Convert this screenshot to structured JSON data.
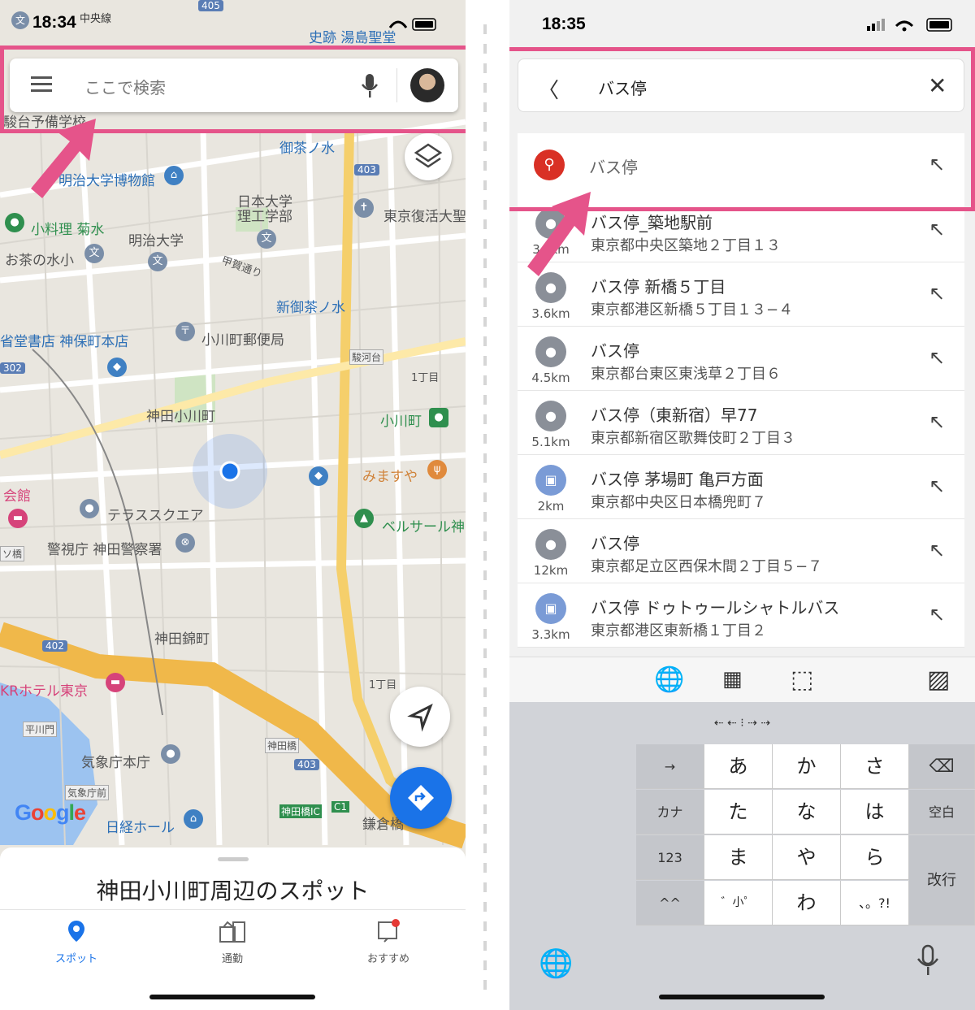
{
  "left": {
    "status": {
      "time": "18:34",
      "line_label": "中央線"
    },
    "search": {
      "placeholder": "ここで検索"
    },
    "map_labels": [
      {
        "t": "史跡 湯島聖堂",
        "c": "blue"
      },
      {
        "t": "駿台予備学校",
        "c": ""
      },
      {
        "t": "御茶ノ水",
        "c": "blue"
      },
      {
        "t": "明治大学博物館",
        "c": "blue"
      },
      {
        "t": "日本大学",
        "c": ""
      },
      {
        "t": "理工学部",
        "c": ""
      },
      {
        "t": "東京復活大聖",
        "c": ""
      },
      {
        "t": "小料理 菊水",
        "c": "green"
      },
      {
        "t": "明治大学",
        "c": ""
      },
      {
        "t": "お茶の水小",
        "c": ""
      },
      {
        "t": "甲賀通り",
        "c": ""
      },
      {
        "t": "新御茶ノ水",
        "c": "blue"
      },
      {
        "t": "省堂書店 神保町本店",
        "c": "blue"
      },
      {
        "t": "小川町郵便局",
        "c": ""
      },
      {
        "t": "駿河台",
        "c": ""
      },
      {
        "t": "1丁目",
        "c": ""
      },
      {
        "t": "神田小川町",
        "c": ""
      },
      {
        "t": "小川町",
        "c": "green"
      },
      {
        "t": "みますや",
        "c": "orange"
      },
      {
        "t": "会館",
        "c": "pink"
      },
      {
        "t": "テラススクエア",
        "c": ""
      },
      {
        "t": "ベルサール神",
        "c": "green"
      },
      {
        "t": "警視庁 神田警察署",
        "c": ""
      },
      {
        "t": "ソ橋",
        "c": ""
      },
      {
        "t": "神田錦町",
        "c": ""
      },
      {
        "t": "KRホテル東京",
        "c": "pink"
      },
      {
        "t": "1丁目",
        "c": ""
      },
      {
        "t": "平川門",
        "c": ""
      },
      {
        "t": "神田橋",
        "c": ""
      },
      {
        "t": "気象庁本庁",
        "c": ""
      },
      {
        "t": "気象庁前",
        "c": ""
      },
      {
        "t": "日経ホール",
        "c": "blue"
      },
      {
        "t": "神田橋IC",
        "c": "green"
      },
      {
        "t": "C1",
        "c": "green"
      },
      {
        "t": "鎌倉橋",
        "c": ""
      }
    ],
    "road_numbers": [
      "405",
      "403",
      "302",
      "402",
      "403"
    ],
    "google_logo": "Google",
    "sheet": {
      "title": "神田小川町周辺のスポット"
    },
    "tabs": [
      {
        "label": "スポット",
        "icon": "location-pin-icon"
      },
      {
        "label": "通勤",
        "icon": "commute-icon"
      },
      {
        "label": "おすすめ",
        "icon": "recommended-icon"
      }
    ]
  },
  "right": {
    "status": {
      "time": "18:35"
    },
    "search": {
      "query": "バス停"
    },
    "top_suggestion": "バス停",
    "results": [
      {
        "name": "バス停_築地駅前",
        "address": "東京都中央区築地２丁目１３",
        "dist": "3.?km",
        "icon": "pin"
      },
      {
        "name": "バス停 新橋５丁目",
        "address": "東京都港区新橋５丁目１３−４",
        "dist": "3.6km",
        "icon": "pin"
      },
      {
        "name": "バス停",
        "address": "東京都台東区東浅草２丁目６",
        "dist": "4.5km",
        "icon": "pin"
      },
      {
        "name": "バス停（東新宿）早77",
        "address": "東京都新宿区歌舞伎町２丁目３",
        "dist": "5.1km",
        "icon": "pin"
      },
      {
        "name": "バス停 茅場町 亀戸方面",
        "address": "東京都中央区日本橋兜町７",
        "dist": "2km",
        "icon": "bus"
      },
      {
        "name": "バス停",
        "address": "東京都足立区西保木間２丁目５−７",
        "dist": "12km",
        "icon": "pin"
      },
      {
        "name": "バス停 ドゥトゥールシャトルバス",
        "address": "東京都港区東新橋１丁目２",
        "dist": "3.3km",
        "icon": "bus"
      }
    ],
    "keyboard": {
      "keys": [
        "あ",
        "か",
        "さ",
        "た",
        "な",
        "は",
        "ま",
        "や",
        "ら",
        "゛小゜",
        "わ",
        "、。?!"
      ],
      "fn_left": [
        "→",
        "カナ",
        "123",
        "^^"
      ],
      "fn_right": [
        "⌫",
        "空白",
        "改行"
      ]
    }
  },
  "colors": {
    "highlight": "#e5548a",
    "accent": "#1a73e8",
    "search_red": "#d93025"
  }
}
